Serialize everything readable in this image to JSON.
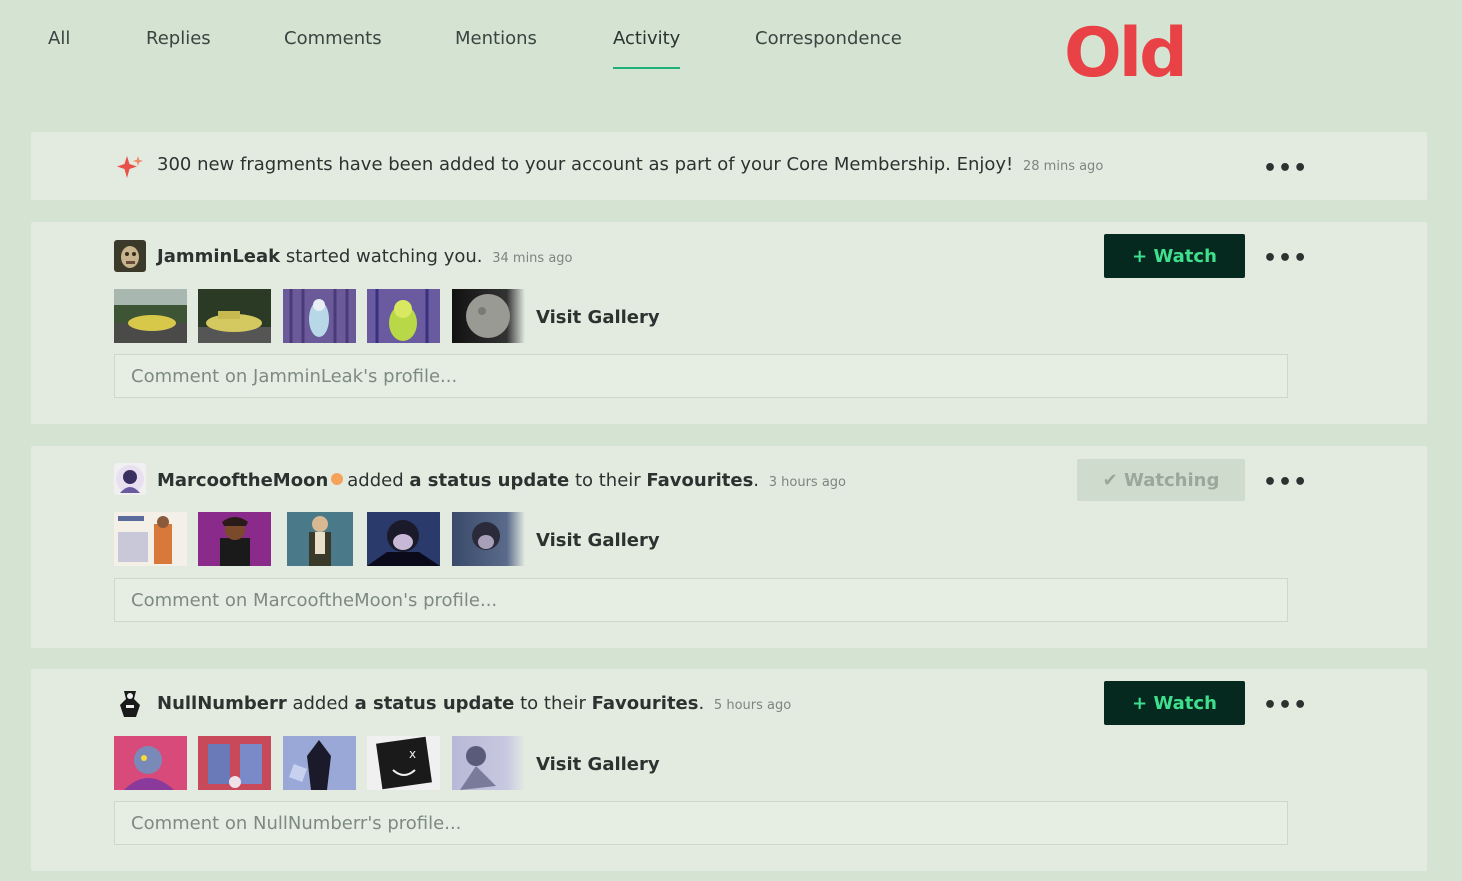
{
  "tabs": [
    "All",
    "Replies",
    "Comments",
    "Mentions",
    "Activity",
    "Correspondence"
  ],
  "overlay_label": "Old",
  "notice": {
    "text": "300 new fragments have been added to your account as part of your Core Membership. Enjoy!",
    "time": "28 mins ago",
    "icon": "sparkle-icon"
  },
  "more_label": "•••",
  "visit_gallery": "Visit Gallery",
  "feed": [
    {
      "user": "JamminLeak",
      "action": "started watching you.",
      "time": "34 mins ago",
      "button": "+ Watch",
      "comment_placeholder": "Comment on JamminLeak's profile..."
    },
    {
      "user": "MarcooftheMoon",
      "action_pre": "added",
      "action_bold": "a status update",
      "action_mid": "to their",
      "action_target": "Favourites",
      "time": "3 hours ago",
      "button": "✔ Watching",
      "comment_placeholder": "Comment on MarcooftheMoon's profile..."
    },
    {
      "user": "NullNumberr",
      "action_pre": "added",
      "action_bold": "a status update",
      "action_mid": "to their",
      "action_target": "Favourites",
      "time": "5 hours ago",
      "button": "+ Watch",
      "comment_placeholder": "Comment on NullNumberr's profile..."
    }
  ],
  "colors": {
    "background": "#d5e3d3",
    "card": "#e3ebe1",
    "accent": "#1fb07a",
    "watch_bg": "#05291f",
    "watch_text": "#3ee08d",
    "old_red": "#e84246"
  }
}
